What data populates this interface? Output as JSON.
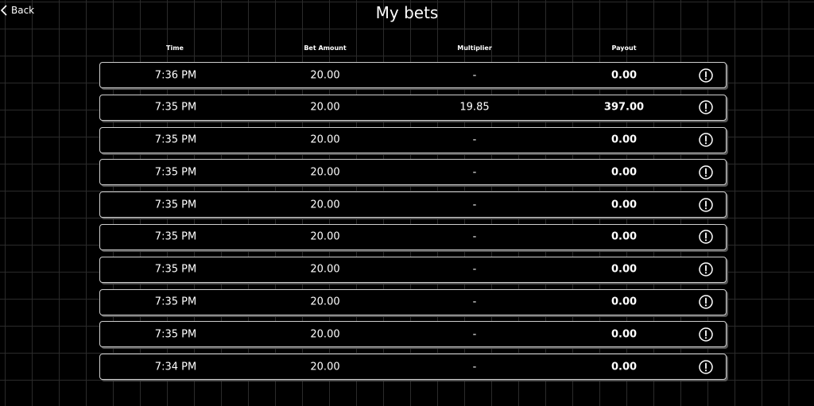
{
  "header": {
    "back_label": "Back",
    "title": "My bets"
  },
  "columns": {
    "time": "Time",
    "bet_amount": "Bet Amount",
    "multiplier": "Multiplier",
    "payout": "Payout"
  },
  "bets": [
    {
      "time": "7:36 PM",
      "amount": "20.00",
      "multiplier": "-",
      "payout": "0.00"
    },
    {
      "time": "7:35 PM",
      "amount": "20.00",
      "multiplier": "19.85",
      "payout": "397.00"
    },
    {
      "time": "7:35 PM",
      "amount": "20.00",
      "multiplier": "-",
      "payout": "0.00"
    },
    {
      "time": "7:35 PM",
      "amount": "20.00",
      "multiplier": "-",
      "payout": "0.00"
    },
    {
      "time": "7:35 PM",
      "amount": "20.00",
      "multiplier": "-",
      "payout": "0.00"
    },
    {
      "time": "7:35 PM",
      "amount": "20.00",
      "multiplier": "-",
      "payout": "0.00"
    },
    {
      "time": "7:35 PM",
      "amount": "20.00",
      "multiplier": "-",
      "payout": "0.00"
    },
    {
      "time": "7:35 PM",
      "amount": "20.00",
      "multiplier": "-",
      "payout": "0.00"
    },
    {
      "time": "7:35 PM",
      "amount": "20.00",
      "multiplier": "-",
      "payout": "0.00"
    },
    {
      "time": "7:34 PM",
      "amount": "20.00",
      "multiplier": "-",
      "payout": "0.00"
    }
  ],
  "icons": {
    "back": "chevron-left-icon",
    "row_action": "info-circle-icon"
  }
}
